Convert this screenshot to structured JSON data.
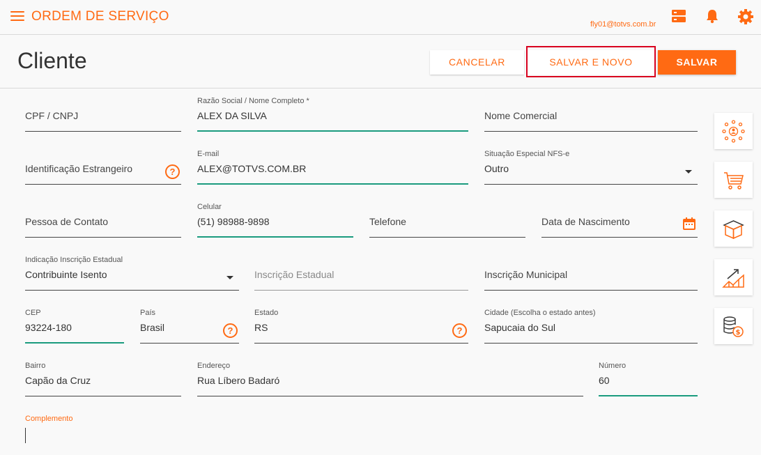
{
  "app": {
    "title": "ORDEM DE SERVIÇO",
    "user_email": "fly01@totvs.com.br"
  },
  "page": {
    "title": "Cliente"
  },
  "actions": {
    "cancel": "CANCELAR",
    "save_and_new": "SALVAR E NOVO",
    "save": "SALVAR"
  },
  "form": {
    "cpf_cnpj": {
      "placeholder": "CPF / CNPJ"
    },
    "razao_social": {
      "label": "Razão Social / Nome Completo *",
      "value": "ALEX DA SILVA"
    },
    "nome_comercial": {
      "placeholder": "Nome Comercial"
    },
    "identificacao_estrangeiro": {
      "placeholder": "Identificação Estrangeiro"
    },
    "email": {
      "label": "E-mail",
      "value": "ALEX@TOTVS.COM.BR"
    },
    "situacao_nfse": {
      "label": "Situação Especial NFS-e",
      "value": "Outro"
    },
    "pessoa_contato": {
      "placeholder": "Pessoa de Contato"
    },
    "celular": {
      "label": "Celular",
      "value": "(51) 98988-9898"
    },
    "telefone": {
      "placeholder": "Telefone"
    },
    "data_nascimento": {
      "placeholder": "Data de Nascimento"
    },
    "indicacao_ie": {
      "label": "Indicação Inscrição Estadual",
      "value": "Contribuinte Isento"
    },
    "inscricao_estadual": {
      "placeholder": "Inscrição Estadual"
    },
    "inscricao_municipal": {
      "placeholder": "Inscrição Municipal"
    },
    "cep": {
      "label": "CEP",
      "value": "93224-180"
    },
    "pais": {
      "label": "País",
      "value": "Brasil"
    },
    "estado": {
      "label": "Estado",
      "value": "RS"
    },
    "cidade": {
      "label": "Cidade (Escolha o estado antes)",
      "value": "Sapucaia do Sul"
    },
    "bairro": {
      "label": "Bairro",
      "value": "Capão da Cruz"
    },
    "endereco": {
      "label": "Endereço",
      "value": "Rua Líbero Badaró"
    },
    "numero": {
      "label": "Número",
      "value": "60"
    },
    "complemento": {
      "label": "Complemento"
    }
  },
  "help_glyph": "?",
  "colors": {
    "accent": "#ff6a13",
    "active_line": "#1a9b7e",
    "highlight_outline": "#d8001e"
  }
}
